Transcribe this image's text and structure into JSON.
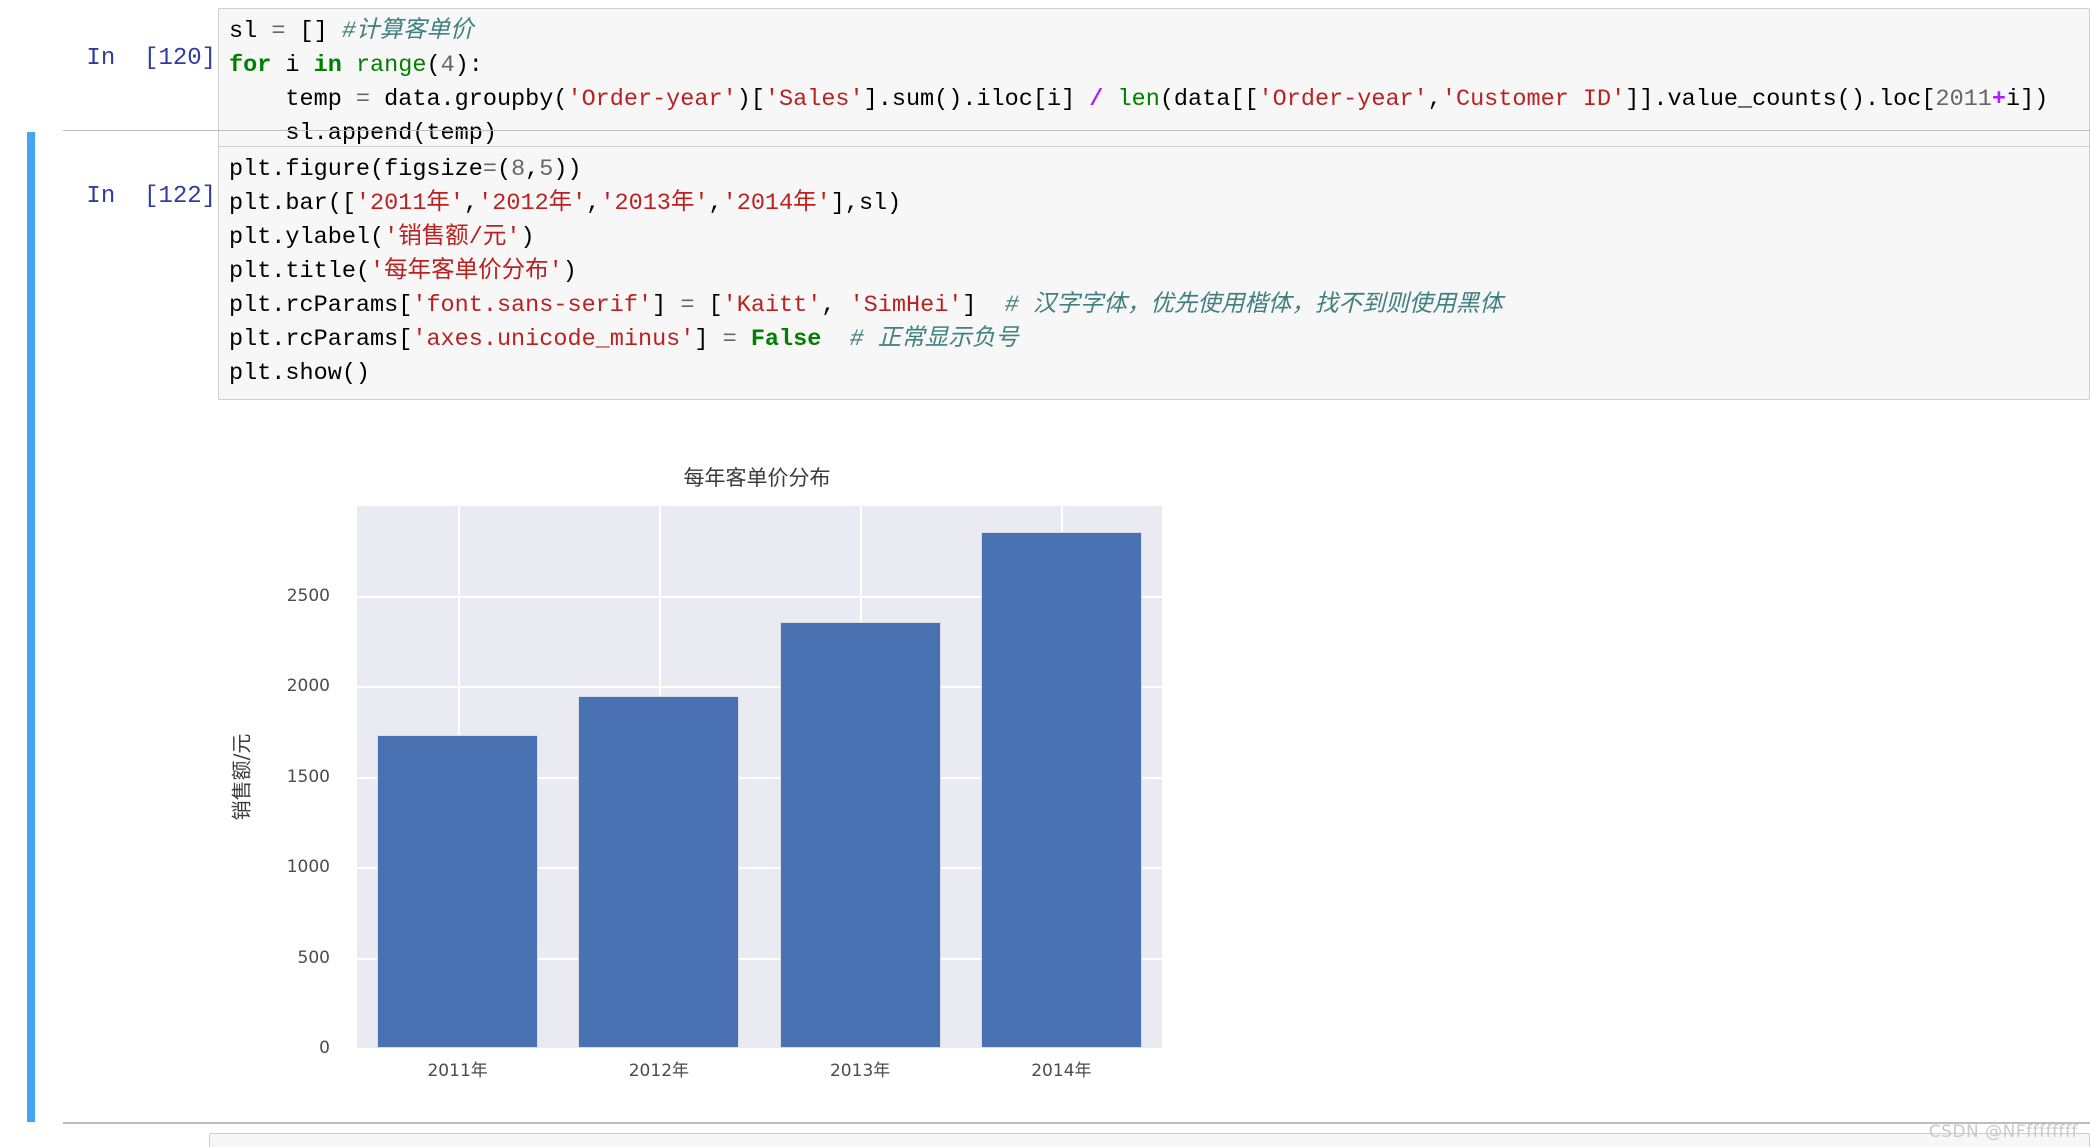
{
  "notebook": {
    "cells": [
      {
        "id": "cell-120",
        "prompt_label": "In",
        "prompt_count": "[120]:",
        "selected": false,
        "lines": [
          [
            {
              "t": "sl ",
              "c": "plain"
            },
            {
              "t": "=",
              "c": "op"
            },
            {
              "t": " [] ",
              "c": "plain"
            },
            {
              "t": "#计算客单价",
              "c": "comment"
            }
          ],
          [
            {
              "t": "for",
              "c": "keyword"
            },
            {
              "t": " i ",
              "c": "plain"
            },
            {
              "t": "in",
              "c": "keyword"
            },
            {
              "t": " ",
              "c": "plain"
            },
            {
              "t": "range",
              "c": "builtin"
            },
            {
              "t": "(",
              "c": "plain"
            },
            {
              "t": "4",
              "c": "number"
            },
            {
              "t": "):",
              "c": "plain"
            }
          ],
          [
            {
              "t": "    temp ",
              "c": "plain"
            },
            {
              "t": "=",
              "c": "op"
            },
            {
              "t": " data.groupby(",
              "c": "plain"
            },
            {
              "t": "'Order-year'",
              "c": "string"
            },
            {
              "t": ")[",
              "c": "plain"
            },
            {
              "t": "'Sales'",
              "c": "string"
            },
            {
              "t": "].sum().iloc[i] ",
              "c": "plain"
            },
            {
              "t": "/",
              "c": "operator-bold"
            },
            {
              "t": " ",
              "c": "plain"
            },
            {
              "t": "len",
              "c": "builtin"
            },
            {
              "t": "(data[[",
              "c": "plain"
            },
            {
              "t": "'Order-year'",
              "c": "string"
            },
            {
              "t": ",",
              "c": "plain"
            },
            {
              "t": "'Customer ID'",
              "c": "string"
            },
            {
              "t": "]].value_counts().loc[",
              "c": "plain"
            },
            {
              "t": "2011",
              "c": "number"
            },
            {
              "t": "+",
              "c": "operator-bold"
            },
            {
              "t": "i])",
              "c": "plain"
            }
          ],
          [
            {
              "t": "    sl.append(temp)",
              "c": "plain"
            }
          ]
        ]
      },
      {
        "id": "cell-122",
        "prompt_label": "In",
        "prompt_count": "[122]:",
        "selected": true,
        "lines": [
          [
            {
              "t": "plt.figure(figsize",
              "c": "plain"
            },
            {
              "t": "=",
              "c": "op"
            },
            {
              "t": "(",
              "c": "plain"
            },
            {
              "t": "8",
              "c": "number"
            },
            {
              "t": ",",
              "c": "plain"
            },
            {
              "t": "5",
              "c": "number"
            },
            {
              "t": "))",
              "c": "plain"
            }
          ],
          [
            {
              "t": "plt.bar([",
              "c": "plain"
            },
            {
              "t": "'2011年'",
              "c": "string"
            },
            {
              "t": ",",
              "c": "plain"
            },
            {
              "t": "'2012年'",
              "c": "string"
            },
            {
              "t": ",",
              "c": "plain"
            },
            {
              "t": "'2013年'",
              "c": "string"
            },
            {
              "t": ",",
              "c": "plain"
            },
            {
              "t": "'2014年'",
              "c": "string"
            },
            {
              "t": "],sl)",
              "c": "plain"
            }
          ],
          [
            {
              "t": "plt.ylabel(",
              "c": "plain"
            },
            {
              "t": "'销售额/元'",
              "c": "string"
            },
            {
              "t": ")",
              "c": "plain"
            }
          ],
          [
            {
              "t": "plt.title(",
              "c": "plain"
            },
            {
              "t": "'每年客单价分布'",
              "c": "string"
            },
            {
              "t": ")",
              "c": "plain"
            }
          ],
          [
            {
              "t": "plt.rcParams[",
              "c": "plain"
            },
            {
              "t": "'font.sans-serif'",
              "c": "string"
            },
            {
              "t": "] ",
              "c": "plain"
            },
            {
              "t": "=",
              "c": "op"
            },
            {
              "t": " [",
              "c": "plain"
            },
            {
              "t": "'Kaitt'",
              "c": "string"
            },
            {
              "t": ", ",
              "c": "plain"
            },
            {
              "t": "'SimHei'",
              "c": "string"
            },
            {
              "t": "]  ",
              "c": "plain"
            },
            {
              "t": "# 汉字字体，优先使用楷体，找不到则使用黑体",
              "c": "comment"
            }
          ],
          [
            {
              "t": "plt.rcParams[",
              "c": "plain"
            },
            {
              "t": "'axes.unicode_minus'",
              "c": "string"
            },
            {
              "t": "] ",
              "c": "plain"
            },
            {
              "t": "=",
              "c": "op"
            },
            {
              "t": " ",
              "c": "plain"
            },
            {
              "t": "False",
              "c": "keyword"
            },
            {
              "t": "  ",
              "c": "plain"
            },
            {
              "t": "# 正常显示负号",
              "c": "comment"
            }
          ],
          [
            {
              "t": "plt.show()",
              "c": "plain"
            }
          ]
        ]
      }
    ],
    "watermark": "CSDN @NFffffffff"
  },
  "chart_data": {
    "type": "bar",
    "title": "每年客单价分布",
    "xlabel": "",
    "ylabel": "销售额/元",
    "categories": [
      "2011年",
      "2012年",
      "2013年",
      "2014年"
    ],
    "values": [
      1728,
      1943,
      2352,
      2854
    ],
    "ylim": [
      0,
      2995
    ],
    "yticks": [
      0,
      500,
      1000,
      1500,
      2000,
      2500
    ],
    "ytick_labels": [
      "0",
      "500",
      "1000",
      "1500",
      "2000",
      "2500"
    ],
    "grid": true,
    "legend": false,
    "bar_color": "#4a72b2",
    "plot_bg": "#eaeaf2",
    "grid_color": "#ffffff"
  }
}
